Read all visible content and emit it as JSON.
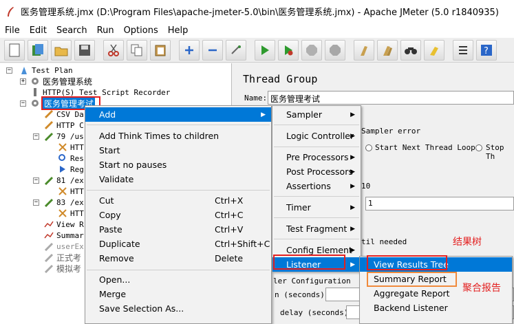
{
  "window": {
    "title": "医务管理系统.jmx (D:\\Program Files\\apache-jmeter-5.0\\bin\\医务管理系统.jmx) - Apache JMeter (5.0 r1840935)"
  },
  "menubar": [
    "File",
    "Edit",
    "Search",
    "Run",
    "Options",
    "Help"
  ],
  "tree": {
    "test_plan": "Test Plan",
    "sys": "医务管理系统",
    "recorder": "HTTP(S) Test Script Recorder",
    "group": "医务管理考试",
    "n1": "CSV Da",
    "n2": "HTTP C",
    "n3": "79 /us",
    "n4": "HTT",
    "n5": "Res",
    "n6": "Reg",
    "n7": "81 /ex",
    "n8": "HTT",
    "n9": "83 /ex",
    "n10": "HTT",
    "n11": "View R",
    "n12": "Summar",
    "n13": "userEx",
    "n14": "正式考",
    "n15": "模拟考"
  },
  "panel": {
    "title": "Thread Group",
    "name_label": "Name:",
    "name_value": "医务管理考试",
    "sampler_error": "Sampler error",
    "opt_next_loop": "Start Next Thread Loop",
    "opt_stop": "Stop Th",
    "field1": "10",
    "field2": "1",
    "until_needed": "til needed",
    "sched_conf": "ler Configuration",
    "duration": "n (seconds)",
    "delay": "delay (seconds)"
  },
  "context_menu": {
    "add": "Add",
    "think": "Add Think Times to children",
    "start": "Start",
    "start_np": "Start no pauses",
    "validate": "Validate",
    "cut": "Cut",
    "cut_sc": "Ctrl+X",
    "copy": "Copy",
    "copy_sc": "Ctrl+C",
    "paste": "Paste",
    "paste_sc": "Ctrl+V",
    "dup": "Duplicate",
    "dup_sc": "Ctrl+Shift+C",
    "remove": "Remove",
    "remove_sc": "Delete",
    "open": "Open...",
    "merge": "Merge",
    "save_sel": "Save Selection As..."
  },
  "add_menu": {
    "sampler": "Sampler",
    "logic": "Logic Controller",
    "pre": "Pre Processors",
    "post": "Post Processors",
    "assert": "Assertions",
    "timer": "Timer",
    "frag": "Test Fragment",
    "config": "Config Element",
    "listener": "Listener"
  },
  "listener_menu": {
    "vrt": "View Results Tree",
    "summary": "Summary Report",
    "aggregate": "Aggregate Report",
    "backend": "Backend Listener"
  },
  "annotations": {
    "tree_note": "结果树",
    "agg_note": "聚合报告"
  }
}
